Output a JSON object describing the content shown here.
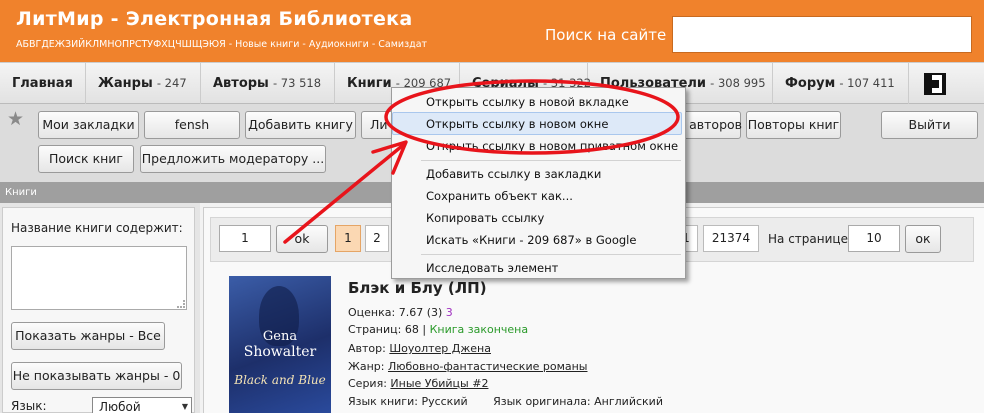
{
  "header": {
    "site_title": "ЛитМир - Электронная Библиотека",
    "subnav": "АБВГДЕЖЗИЙКЛМНОПРСТУФХЦЧШЩЭЮЯ - Новые книги - Аудиокниги - Самиздат",
    "search_label": "Поиск на сайте",
    "search_value": ""
  },
  "mainnav": {
    "items": [
      {
        "label": "Главная",
        "count": ""
      },
      {
        "label": "Жанры",
        "count": "- 247"
      },
      {
        "label": "Авторы",
        "count": "- 73 518"
      },
      {
        "label": "Книги",
        "count": "- 209 687"
      },
      {
        "label": "Сериалы",
        "count": "- 31 322"
      },
      {
        "label": "Пользователи",
        "count": "- 308 995"
      },
      {
        "label": "Форум",
        "count": "- 107 411"
      }
    ],
    "qr_icon": "qr-code-icon"
  },
  "toolbar": {
    "bookmarks": "Мои закладки",
    "user": "fensh",
    "add_book": "Добавить книгу",
    "personal": "Личный раздел",
    "authors": "Повторы авторов",
    "book_repeats": "Повторы книг",
    "logout": "Выйти",
    "search_books": "Поиск книг",
    "suggest_moderator": "Предложить модератору ..."
  },
  "section": {
    "title": "Книги"
  },
  "sidebar": {
    "title_contains": "Название книги содержит:",
    "title_value": "",
    "show_genres": "Показать жанры - Все",
    "hide_genres": "Не показывать жанры - 0",
    "language_label": "Язык:",
    "language_value": "Любой"
  },
  "pager": {
    "page_input": "1",
    "go": "ok",
    "pages": [
      "1",
      "2"
    ],
    "page_tail": "1",
    "last_page": "21374",
    "per_page_label": "На странице:",
    "per_page_value": "10",
    "per_page_go": "ок"
  },
  "book": {
    "title": "Блэк и Блу (ЛП)",
    "rating_label": "Оценка:",
    "rating_value": "7.67",
    "rating_votes": "(3)",
    "rating_extra": "3",
    "pages_label": "Страниц:",
    "pages_value": "68",
    "status": "Книга закончена",
    "author_label": "Автор:",
    "author": "Шоуолтер Джена",
    "genre_label": "Жанр:",
    "genre": "Любовно-фантастические романы",
    "series_label": "Серия:",
    "series": "Иные Убийцы #2",
    "lang_label": "Язык книги:",
    "lang": "Русский",
    "orig_lang_label": "Язык оригинала:",
    "orig_lang": "Английский",
    "cover": {
      "author_first": "Gena",
      "author_last": "Showalter",
      "title": "Black and Blue"
    }
  },
  "context_menu": {
    "items": [
      "Открыть ссылку в новой вкладке",
      "Открыть ссылку в новом окне",
      "Открыть ссылку в новом приватном окне",
      "Добавить ссылку в закладки",
      "Сохранить объект как...",
      "Копировать ссылку",
      "Искать «Книги - 209 687» в Google",
      "Исследовать элемент"
    ]
  },
  "colors": {
    "header_orange": "#f0822c",
    "annotation_red": "#e8141b",
    "menu_highlight": "#dde9f8"
  }
}
